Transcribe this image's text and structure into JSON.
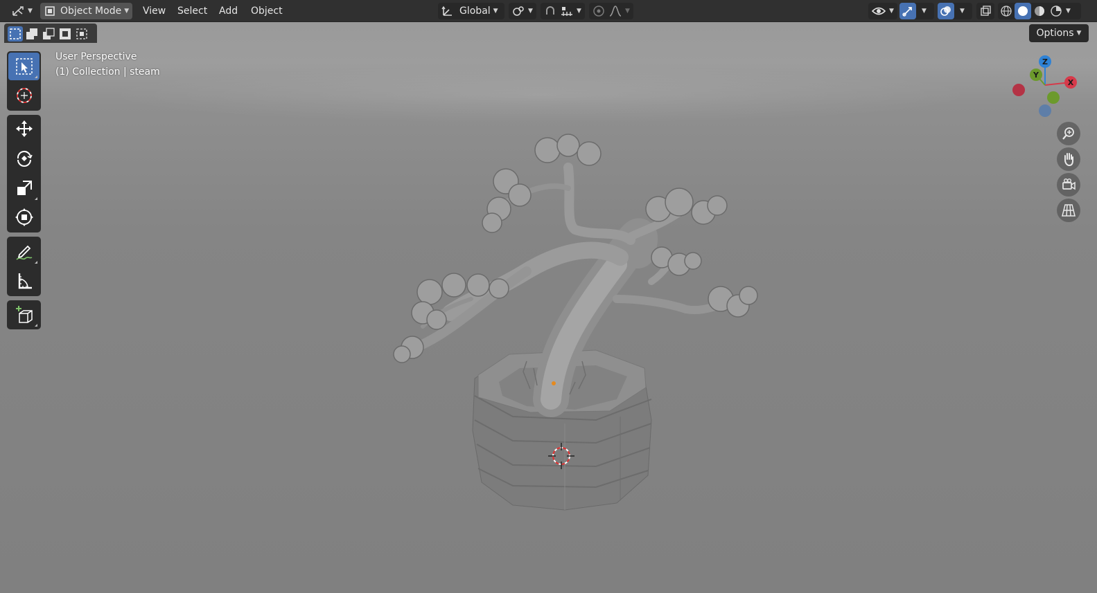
{
  "header": {
    "editor_type_icon": "axis-editor-icon",
    "mode": {
      "label": "Object Mode",
      "icon": "object-mode-icon"
    },
    "menus": [
      "View",
      "Select",
      "Add",
      "Object"
    ],
    "transform_orientation": {
      "label": "Global",
      "icon": "orientation-axes-icon"
    },
    "pivot_icon": "pivot-point-icon",
    "snap_icons": [
      "snap-magnet-icon",
      "snap-increment-icon"
    ],
    "proportional_icons": [
      "proportional-edit-icon",
      "falloff-curve-icon"
    ],
    "right_icons": [
      "visibility-eye-icon",
      "gizmo-toggle-icon",
      "overlay-toggle-icon",
      "xray-toggle-icon"
    ],
    "shading_modes": [
      "wireframe-shading-icon",
      "solid-shading-icon",
      "material-preview-icon",
      "rendered-shading-icon"
    ],
    "active_shading": "solid-shading-icon"
  },
  "tool_settings": {
    "select_modes": [
      "select-new-icon",
      "select-extend-icon",
      "select-subtract-icon",
      "select-invert-icon",
      "select-intersect-icon"
    ],
    "active_select_mode": 0,
    "options_label": "Options"
  },
  "viewport": {
    "view_name": "User Perspective",
    "collection_info": "(1) Collection | steam"
  },
  "toolbar": {
    "tools": [
      "select-box-icon",
      "cursor-icon",
      "move-icon",
      "rotate-icon",
      "scale-icon",
      "transform-icon",
      "annotate-icon",
      "measure-icon",
      "add-cube-icon"
    ],
    "active_tool": "select-box-icon"
  },
  "gizmo": {
    "axes": {
      "x": "X",
      "y": "Y",
      "z": "Z"
    },
    "colors": {
      "x": "#d63a4a",
      "y": "#6c9a2c",
      "z": "#2e82d6",
      "neg_z": "#5e7ea8"
    }
  },
  "nav_buttons": [
    "zoom-icon",
    "pan-hand-icon",
    "camera-view-icon",
    "ortho-grid-icon"
  ],
  "colors": {
    "accent": "#4772b3",
    "header_bg": "#303030",
    "viewport_bg": "#8a8a8a"
  }
}
